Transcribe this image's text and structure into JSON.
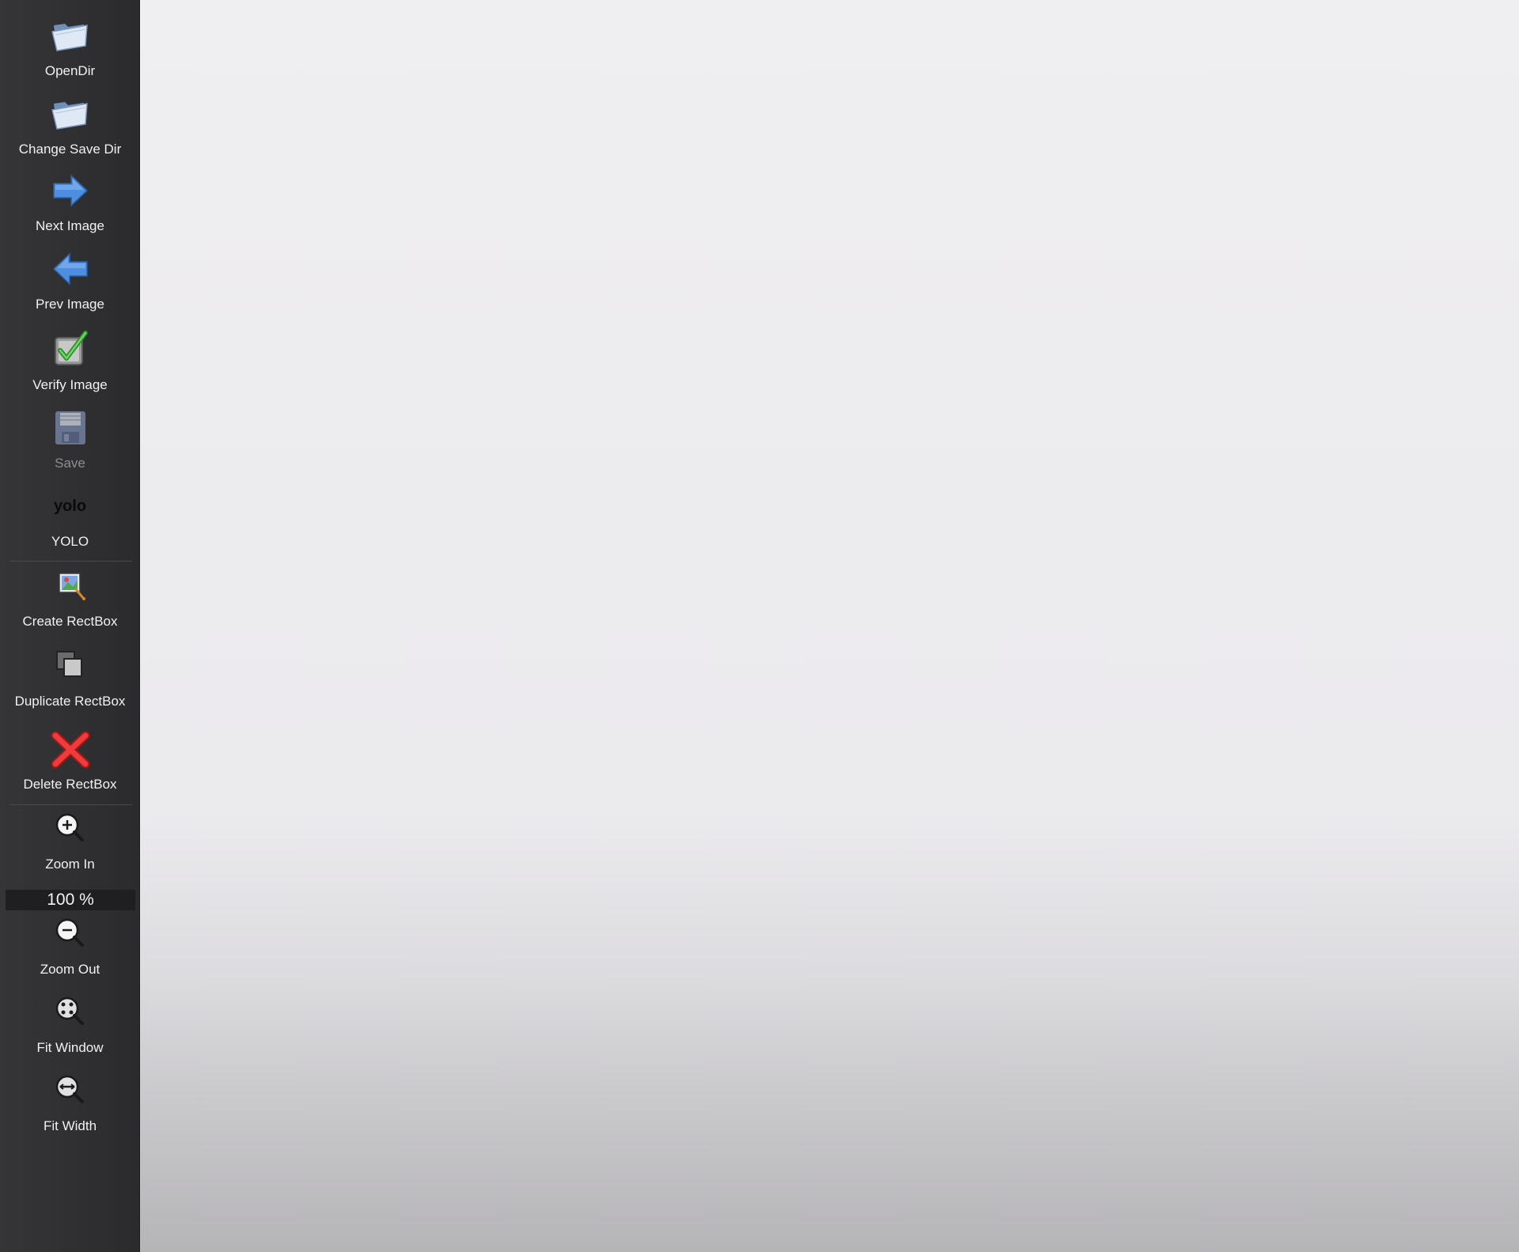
{
  "toolbar": {
    "open_dir": {
      "label": "OpenDir",
      "icon": "folder-open-icon"
    },
    "change_save_dir": {
      "label": "Change Save Dir",
      "icon": "folder-open-icon"
    },
    "next_image": {
      "label": "Next Image",
      "icon": "arrow-right-icon"
    },
    "prev_image": {
      "label": "Prev Image",
      "icon": "arrow-left-icon"
    },
    "verify_image": {
      "label": "Verify Image",
      "icon": "checkbox-check-icon"
    },
    "save": {
      "label": "Save",
      "icon": "floppy-disk-icon",
      "enabled": false
    },
    "yolo": {
      "label": "YOLO",
      "icon_text": "yolo"
    },
    "create_rectbox": {
      "label": "Create RectBox",
      "icon": "create-rect-icon"
    },
    "duplicate_rectbox": {
      "label": "Duplicate RectBox",
      "icon": "duplicate-icon"
    },
    "delete_rectbox": {
      "label": "Delete RectBox",
      "icon": "red-x-icon"
    },
    "zoom_in": {
      "label": "Zoom In",
      "icon": "zoom-in-icon"
    },
    "zoom_value": "100 %",
    "zoom_out": {
      "label": "Zoom Out",
      "icon": "zoom-out-icon"
    },
    "fit_window": {
      "label": "Fit Window",
      "icon": "fit-window-icon"
    },
    "fit_width": {
      "label": "Fit Width",
      "icon": "fit-width-icon"
    }
  },
  "colors": {
    "toolbar_bg": "#2f2f31",
    "canvas_bg": "#ecebee",
    "label_text": "#f1f1f3"
  }
}
